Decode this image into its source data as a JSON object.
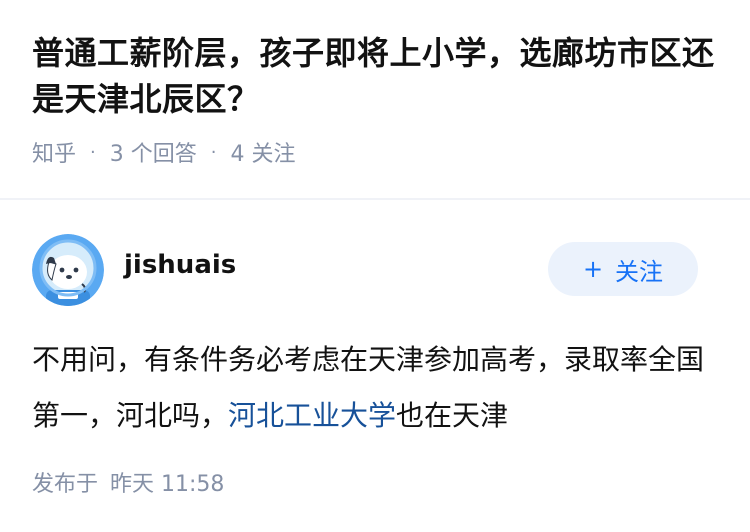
{
  "question": {
    "title": "普通工薪阶层，孩子即将上小学，选廊坊市区还是天津北辰区？",
    "source": "知乎",
    "separator": "·",
    "answer_count": "3 个回答",
    "follower_count": "4 关注"
  },
  "answer": {
    "author": {
      "name": "jishuais"
    },
    "follow_button": {
      "icon": "+",
      "label": "关注"
    },
    "content": {
      "text_before": "不用问，有条件务必考虑在天津参加高考，录取率全国第一，河北吗，",
      "link_text": "河北工业大学",
      "text_after": "也在天津"
    },
    "published": {
      "prefix": "发布于",
      "time": "昨天 11:58"
    }
  },
  "colors": {
    "meta_gray": "#8590a6",
    "accent_blue": "#1772f6",
    "link_blue": "#175199",
    "button_bg": "#ebf2fc"
  }
}
